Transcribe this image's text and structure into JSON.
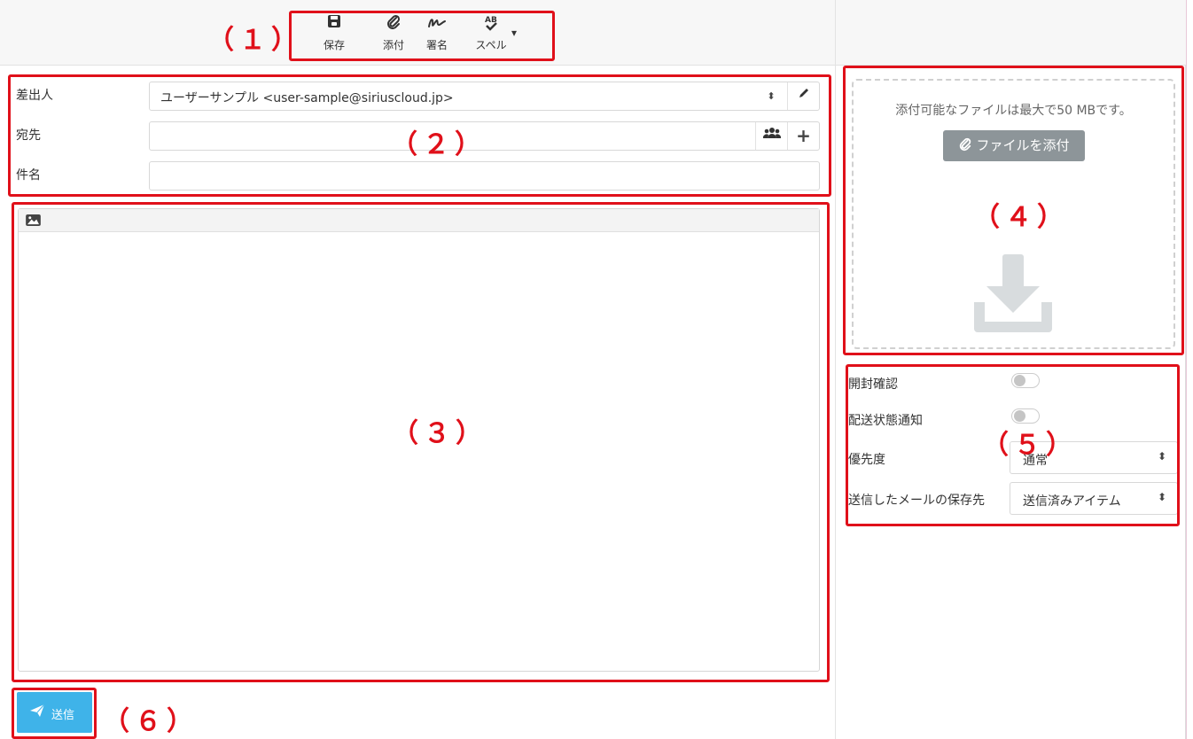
{
  "toolbar": {
    "buttons": [
      {
        "icon": "save-icon",
        "glyph": "🖫",
        "label": "保存"
      },
      {
        "icon": "paperclip-icon",
        "glyph": "🖇",
        "label": "添付"
      },
      {
        "icon": "signature-icon",
        "glyph": "〰",
        "label": "署名"
      },
      {
        "icon": "spellcheck-icon",
        "glyph": "AB✓",
        "label": "スペル"
      }
    ],
    "dropdown_caret": "▾"
  },
  "compose": {
    "from_label": "差出人",
    "from_value": "ユーザーサンプル <user-sample@siriuscloud.jp>",
    "to_label": "宛先",
    "to_value": "",
    "subject_label": "件名",
    "subject_value": ""
  },
  "attachments": {
    "info_text": "添付可能なファイルは最大で50 MBです。",
    "attach_button": "ファイルを添付"
  },
  "options": {
    "read_receipt_label": "開封確認",
    "read_receipt_on": false,
    "delivery_status_label": "配送状態通知",
    "delivery_status_on": false,
    "priority_label": "優先度",
    "priority_value": "通常",
    "save_sent_label": "送信したメールの保存先",
    "save_sent_value": "送信済みアイテム"
  },
  "send_button": "送信",
  "markers": [
    "（１）",
    "（２）",
    "（３）",
    "（４）",
    "（５）",
    "（６）"
  ],
  "colors": {
    "marker_red": "#e0101a",
    "send_blue": "#3fb3e9",
    "attach_gray": "#8d9599"
  }
}
